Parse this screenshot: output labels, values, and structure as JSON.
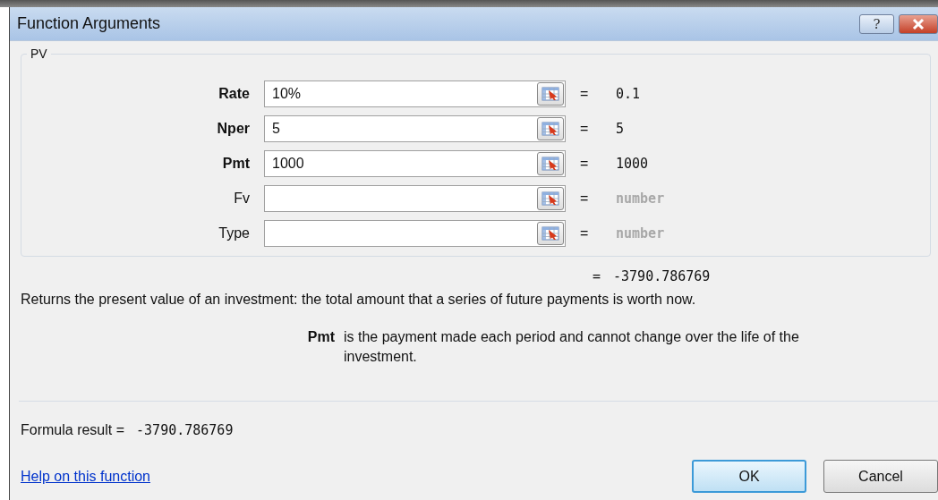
{
  "window": {
    "title": "Function Arguments",
    "help_button": "?"
  },
  "function_group": {
    "name": "PV",
    "arguments": [
      {
        "label": "Rate",
        "required": true,
        "value": "10%",
        "equals": "=",
        "result": "0.1",
        "dimmed": false
      },
      {
        "label": "Nper",
        "required": true,
        "value": "5",
        "equals": "=",
        "result": "5",
        "dimmed": false
      },
      {
        "label": "Pmt",
        "required": true,
        "value": "1000",
        "equals": "=",
        "result": "1000",
        "dimmed": false
      },
      {
        "label": "Fv",
        "required": false,
        "equals": "=",
        "result": "number",
        "dimmed": true
      },
      {
        "label": "Type",
        "required": false,
        "equals": "=",
        "result": "number",
        "dimmed": true
      }
    ]
  },
  "function_result": {
    "equals": "=",
    "value": "-3790.786769"
  },
  "description": "Returns the present value of an investment: the total amount that a series of future payments is worth now.",
  "argument_help": {
    "name": "Pmt",
    "text": "is the payment made each period and cannot change over the life of the investment."
  },
  "formula_result": {
    "label": "Formula result =",
    "value": "-3790.786769"
  },
  "help_link": "Help on this function",
  "buttons": [
    {
      "label": "OK",
      "default": true
    },
    {
      "label": "Cancel",
      "default": false
    }
  ]
}
